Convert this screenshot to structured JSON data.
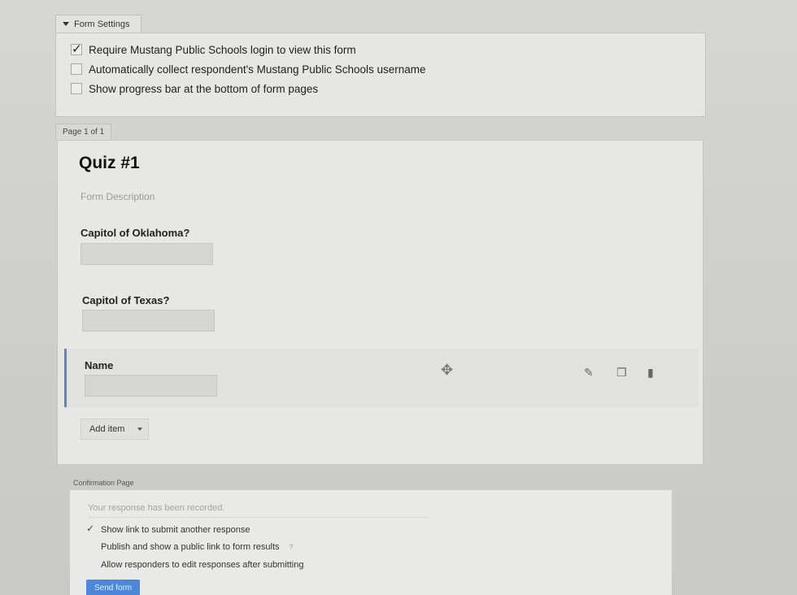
{
  "settings": {
    "tab_label": "Form Settings",
    "options": [
      {
        "label": "Require Mustang Public Schools login to view this form",
        "checked": true
      },
      {
        "label": "Automatically collect respondent's Mustang Public Schools username",
        "checked": false
      },
      {
        "label": "Show progress bar at the bottom of form pages",
        "checked": false
      }
    ]
  },
  "page": {
    "tab_label": "Page 1 of 1",
    "title": "Quiz #1",
    "description_placeholder": "Form Description",
    "questions": [
      {
        "label": "Capitol of Oklahoma?"
      },
      {
        "label": "Capitol of Texas?"
      },
      {
        "label": "Name",
        "selected": true
      }
    ],
    "add_item_label": "Add item"
  },
  "confirmation": {
    "tab_label": "Confirmation Page",
    "message_placeholder": "Your response has been recorded.",
    "options": [
      {
        "label": "Show link to submit another response",
        "checked": true
      },
      {
        "label": "Publish and show a public link to form results",
        "checked": false,
        "help": "?"
      },
      {
        "label": "Allow responders to edit responses after submitting",
        "checked": false
      }
    ],
    "send_label": "Send form"
  },
  "colors": {
    "accent": "#4d87d9",
    "selected_bar": "#5b86c6"
  }
}
